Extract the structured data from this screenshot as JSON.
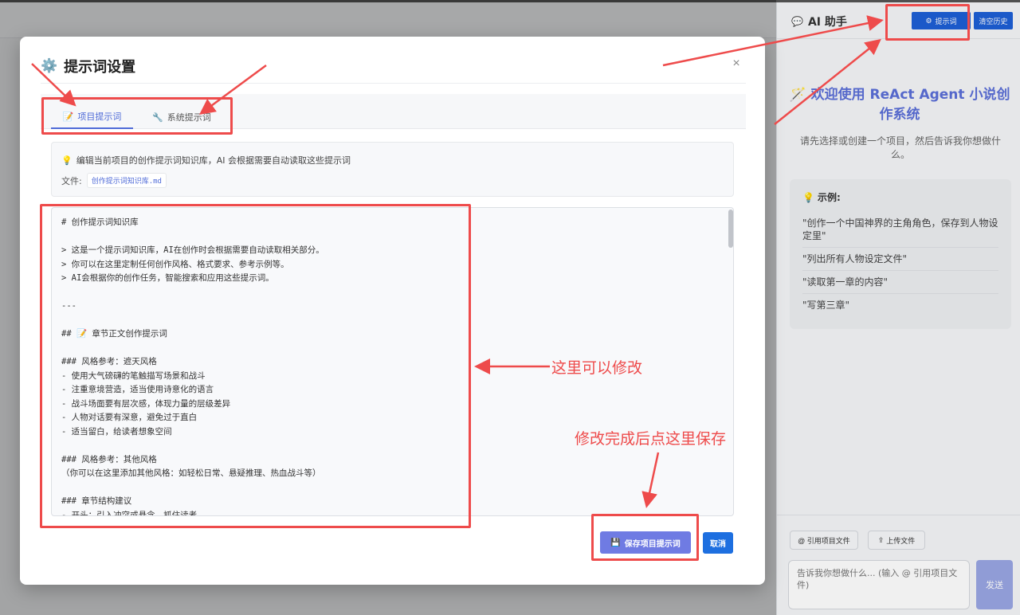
{
  "workspace": {},
  "ai_panel": {
    "title": "AI 助手",
    "title_icon": "speech-bubble-icon",
    "prompt_button": "提示词",
    "clear_button": "清空历史",
    "welcome_title": "欢迎使用 ReAct Agent 小说创作系统",
    "welcome_subtitle": "请先选择或创建一个项目，然后告诉我你想做什么。",
    "examples_title": "示例:",
    "examples": [
      "\"创作一个中国神界的主角角色，保存到人物设定里\"",
      "\"列出所有人物设定文件\"",
      "\"读取第一章的内容\"",
      "\"写第三章\""
    ],
    "ref_file_button": "@ 引用项目文件",
    "upload_button": "上传文件",
    "input_placeholder": "告诉我你想做什么... (输入 @ 引用项目文件)",
    "send_button": "发送"
  },
  "modal": {
    "title": "提示词设置",
    "close_symbol": "×",
    "tabs": [
      {
        "label": "项目提示词",
        "active": true
      },
      {
        "label": "系统提示词",
        "active": false
      }
    ],
    "info_text": "编辑当前项目的创作提示词知识库，AI 会根据需要自动读取这些提示词",
    "file_label": "文件:",
    "file_name": "创作提示词知识库.md",
    "editor_lines": [
      "# 创作提示词知识库",
      "",
      "> 这是一个提示词知识库，AI在创作时会根据需要自动读取相关部分。",
      "> 你可以在这里定制任何创作风格、格式要求、参考示例等。",
      "> AI会根据你的创作任务，智能搜索和应用这些提示词。",
      "",
      "---",
      "",
      "## 📝 章节正文创作提示词",
      "",
      "### 风格参考：遮天风格",
      "- 使用大气磅礴的笔触描写场景和战斗",
      "- 注重意境营造，适当使用诗意化的语言",
      "- 战斗场面要有层次感，体现力量的层级差异",
      "- 人物对话要有深意，避免过于直白",
      "- 适当留白，给读者想象空间",
      "",
      "### 风格参考：其他风格",
      "（你可以在这里添加其他风格：如轻松日常、悬疑推理、热血战斗等）",
      "",
      "### 章节结构建议",
      "- 开头：引入冲突或悬念，抓住读者"
    ],
    "save_button": "保存项目提示词",
    "cancel_button": "取消"
  },
  "annotations": {
    "edit_here": "这里可以修改",
    "save_here": "修改完成后点这里保存"
  },
  "colors": {
    "accent": "#4f6bd8",
    "primary_button": "#1d6fe0",
    "save_button": "#6f7be3",
    "annotation_red": "#ee4b4b"
  }
}
